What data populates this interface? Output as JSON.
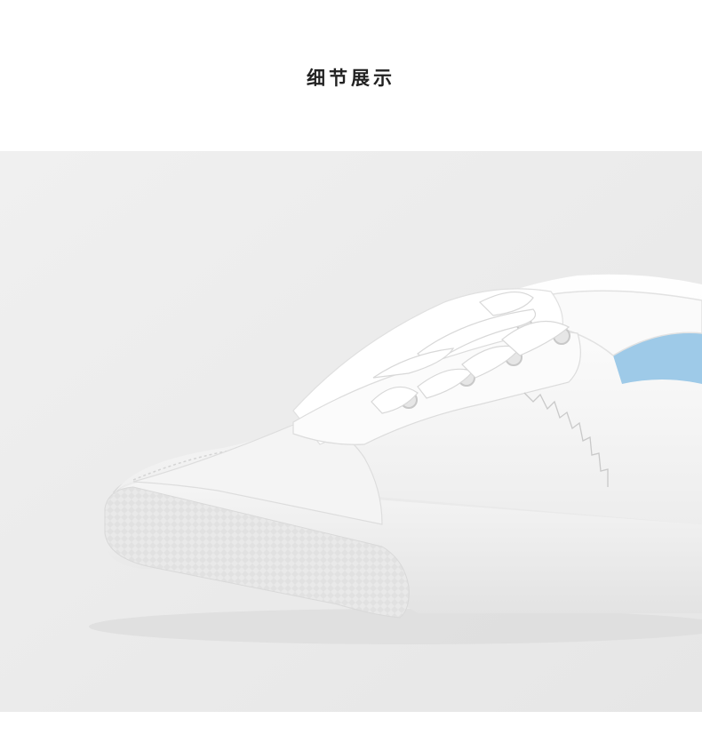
{
  "section": {
    "title": "细节展示"
  },
  "photo": {
    "subject": "white-sneaker-detail",
    "background_color": "#ececec",
    "shoe_color": "#f7f7f7",
    "lining_accent_color": "#9ecae8"
  }
}
